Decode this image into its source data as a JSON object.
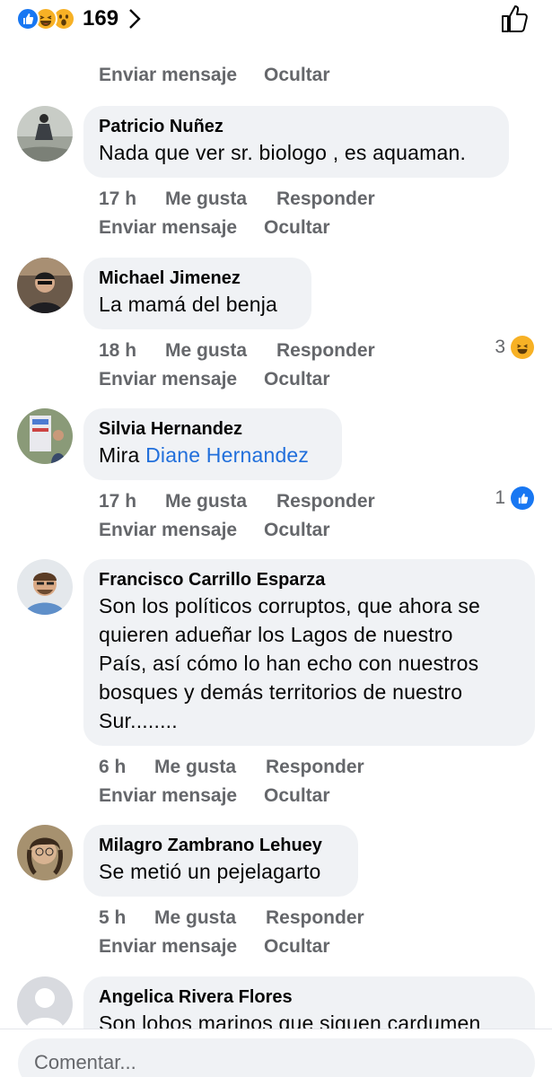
{
  "header": {
    "reaction_count": "169",
    "reaction_icons": [
      "like-icon",
      "haha-icon",
      "wow-icon"
    ],
    "accent": "#1877f2"
  },
  "top_actions": {
    "send_message": "Enviar mensaje",
    "hide": "Ocultar"
  },
  "comments": [
    {
      "author": "Patricio Nuñez",
      "text": "Nada que ver sr. biologo , es aquaman.",
      "time": "17 h",
      "like": "Me gusta",
      "reply": "Responder",
      "send_message": "Enviar mensaje",
      "hide": "Ocultar"
    },
    {
      "author": "Michael Jimenez",
      "text": "La mamá del benja",
      "time": "18 h",
      "like": "Me gusta",
      "reply": "Responder",
      "send_message": "Enviar mensaje",
      "hide": "Ocultar",
      "reactions": "3",
      "reaction_icon": "haha-icon"
    },
    {
      "author": "Silvia Hernandez",
      "text_prefix": "Mira",
      "mention": "Diane Hernandez",
      "time": "17 h",
      "like": "Me gusta",
      "reply": "Responder",
      "send_message": "Enviar mensaje",
      "hide": "Ocultar",
      "reactions": "1",
      "reaction_icon": "like-icon"
    },
    {
      "author": "Francisco Carrillo Esparza",
      "lines": [
        "Son los políticos corruptos, que ahora se",
        "quieren adueñar los Lagos de nuestro",
        "País, así cómo lo han echo con nuestros",
        "bosques y demás territorios de nuestro",
        "Sur........"
      ],
      "time": "6 h",
      "like": "Me gusta",
      "reply": "Responder",
      "send_message": "Enviar mensaje",
      "hide": "Ocultar"
    },
    {
      "author": "Milagro Zambrano Lehuey",
      "text": "Se metió un pejelagarto",
      "time": "5 h",
      "like": "Me gusta",
      "reply": "Responder",
      "send_message": "Enviar mensaje",
      "hide": "Ocultar"
    },
    {
      "author": "Angelica Rivera Flores",
      "text": "Son lobos marinos que siguen cardumen"
    }
  ],
  "composer": {
    "placeholder": "Comentar..."
  }
}
